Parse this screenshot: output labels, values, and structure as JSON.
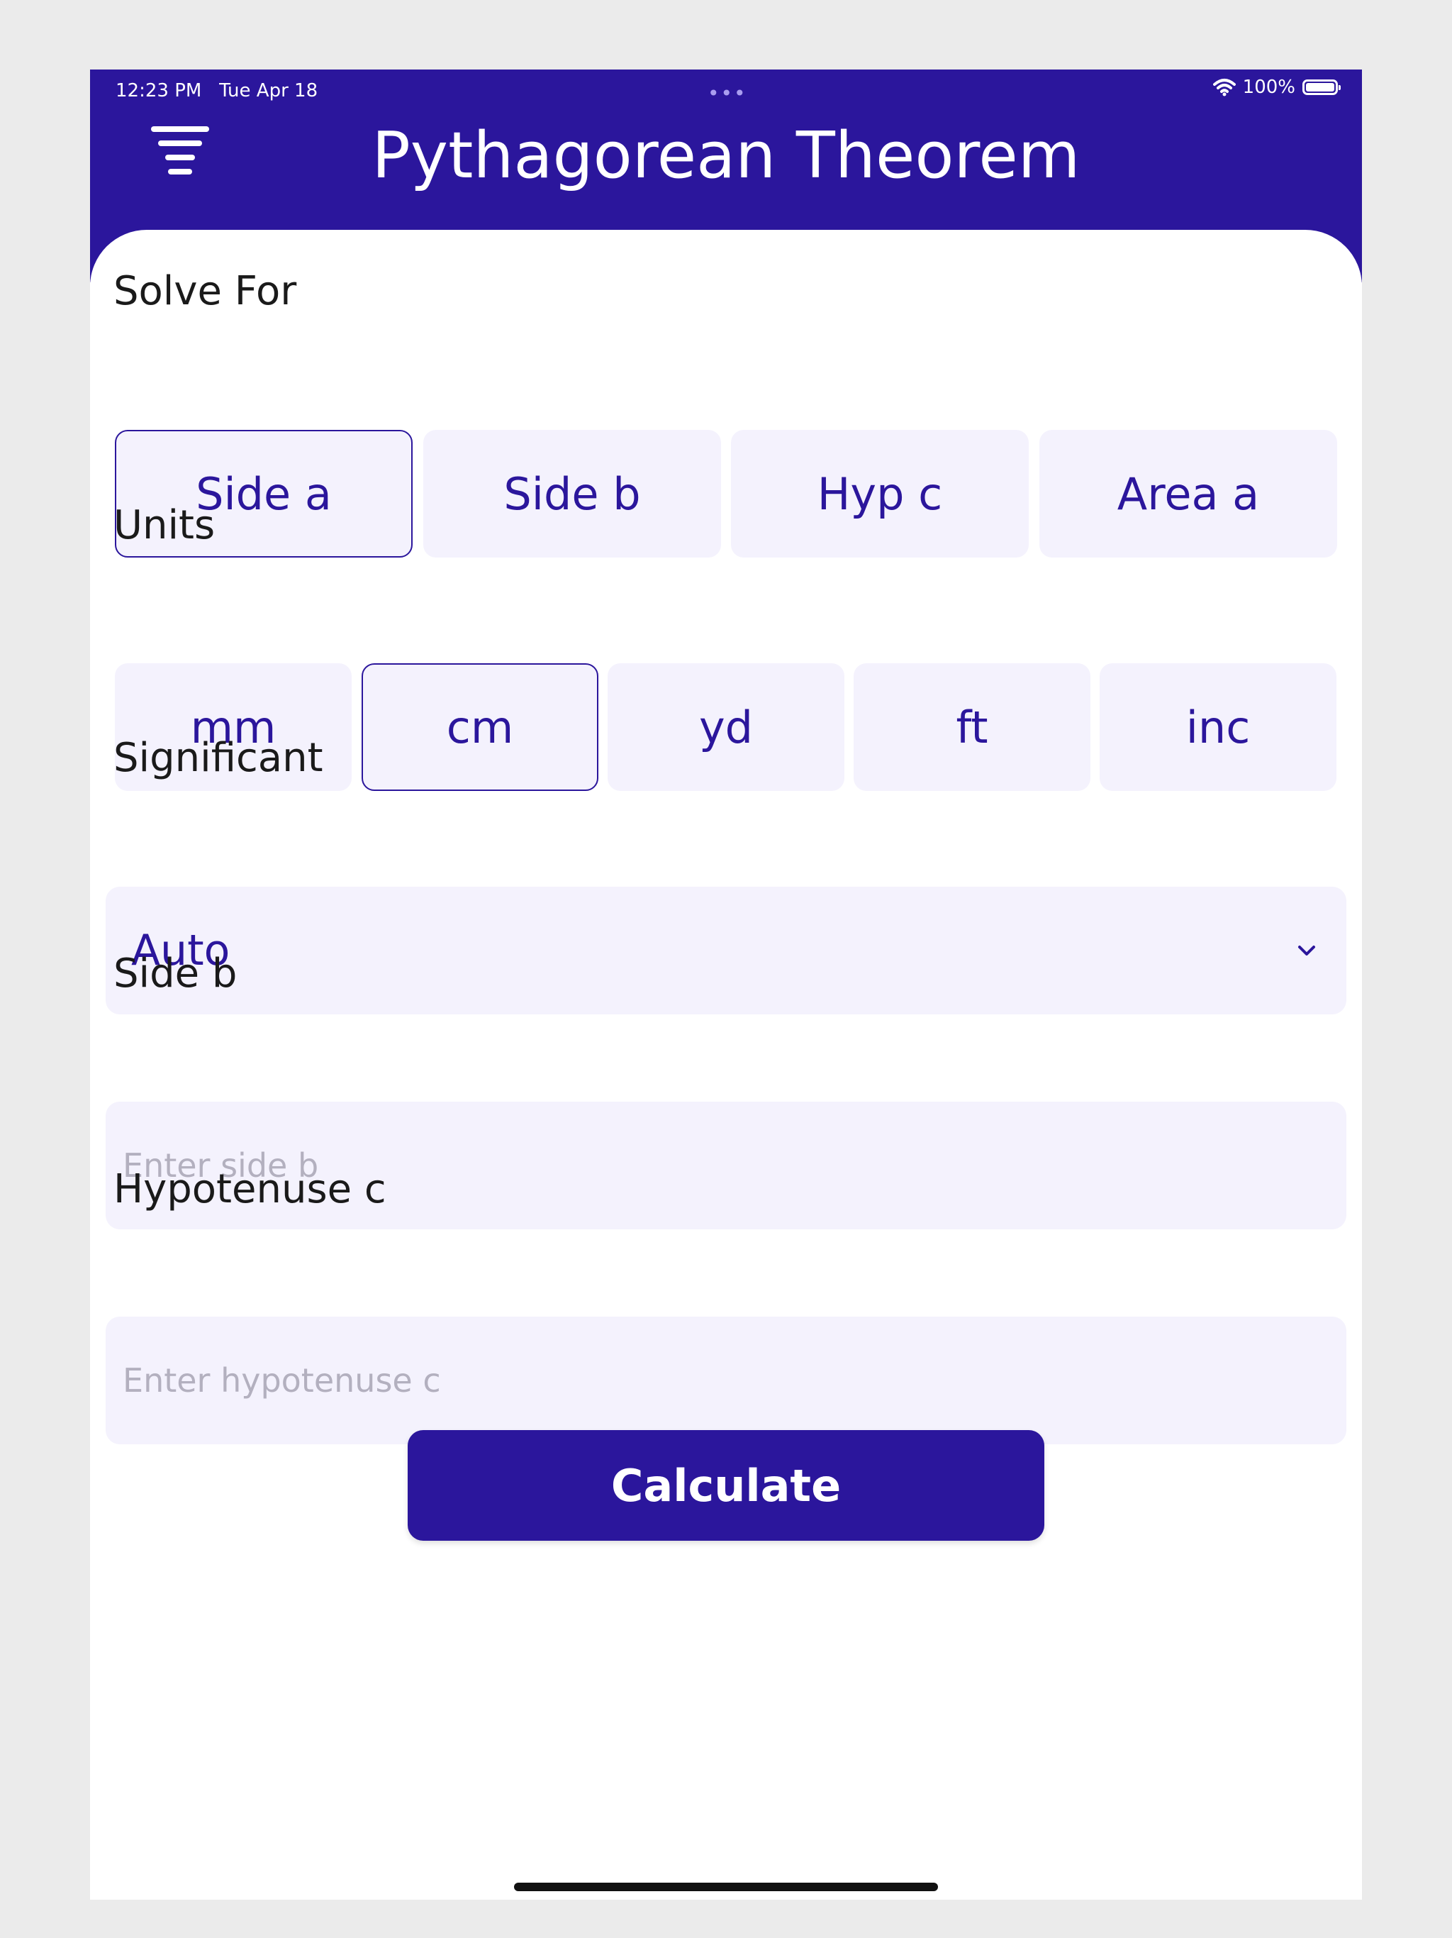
{
  "status_bar": {
    "time": "12:23 PM",
    "date": "Tue Apr 18",
    "dots": "•••",
    "battery": "100%"
  },
  "header": {
    "title": "Pythagorean Theorem",
    "menu_icon": "filter-menu-icon"
  },
  "solve_for": {
    "label": "Solve For",
    "options": [
      "Side a",
      "Side b",
      "Hyp c",
      "Area a"
    ],
    "selected": "Side a"
  },
  "units": {
    "label": "Units",
    "options": [
      "mm",
      "cm",
      "yd",
      "ft",
      "inc"
    ],
    "selected": "cm"
  },
  "significant": {
    "label": "Significant",
    "value": "Auto",
    "icon": "chevron-down-icon"
  },
  "side_b": {
    "label": "Side b",
    "placeholder": "Enter side b",
    "value": ""
  },
  "hypotenuse_c": {
    "label": "Hypotenuse c",
    "placeholder": "Enter hypotenuse c",
    "value": ""
  },
  "calculate_button": "Calculate",
  "colors": {
    "primary": "#2b169c",
    "field_bg": "#f4f2fd",
    "page_bg": "#ebebeb"
  }
}
